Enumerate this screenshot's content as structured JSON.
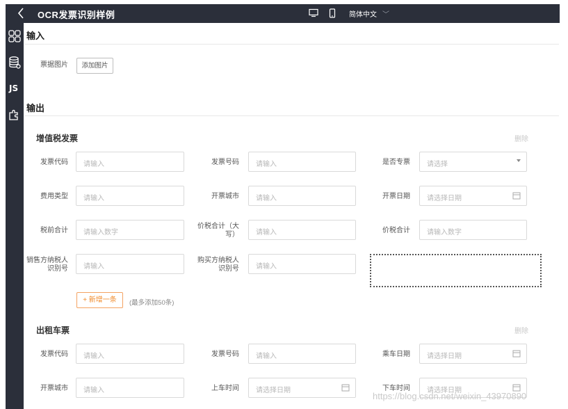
{
  "topbar": {
    "title": "OCR发票识别样例",
    "language": "简体中文"
  },
  "sidebar": {
    "js_label": "JS"
  },
  "input_section": {
    "title": "输入",
    "field_label": "票据图片",
    "add_button": "添加图片"
  },
  "output_section": {
    "title": "输出"
  },
  "vat": {
    "title": "增值税发票",
    "delete": "删除",
    "fields": {
      "invoice_code": {
        "label": "发票代码",
        "placeholder": "请输入"
      },
      "invoice_number": {
        "label": "发票号码",
        "placeholder": "请输入"
      },
      "is_special": {
        "label": "是否专票",
        "placeholder": "请选择"
      },
      "fee_type": {
        "label": "费用类型",
        "placeholder": "请输入"
      },
      "issue_city": {
        "label": "开票城市",
        "placeholder": "请输入"
      },
      "issue_date": {
        "label": "开票日期",
        "placeholder": "请选择日期"
      },
      "pretax_total": {
        "label": "税前合计",
        "placeholder": "请输入数字"
      },
      "total_upper_l1": "价税合计（大",
      "total_upper_l2": "写）",
      "total_upper_placeholder": "请输入",
      "total": {
        "label": "价税合计",
        "placeholder": "请输入数字"
      },
      "seller_l1": "销售方纳税人",
      "seller_l2": "识别号",
      "seller_placeholder": "请输入",
      "buyer_l1": "购买方纳税人",
      "buyer_l2": "识别号",
      "buyer_placeholder": "请输入"
    },
    "add_row": "+ 新增一条",
    "add_hint": "(最多添加50条)"
  },
  "taxi": {
    "title": "出租车票",
    "delete": "删除",
    "fields": {
      "invoice_code": {
        "label": "发票代码",
        "placeholder": "请输入"
      },
      "invoice_number": {
        "label": "发票号码",
        "placeholder": "请输入"
      },
      "ride_date": {
        "label": "乘车日期",
        "placeholder": "请选择日期"
      },
      "issue_city": {
        "label": "开票城市",
        "placeholder": "请输入"
      },
      "board_time": {
        "label": "上车时间",
        "placeholder": "请选择日期"
      },
      "alight_time": {
        "label": "下车时间",
        "placeholder": "请选择日期"
      }
    }
  },
  "watermark": "https://blog.csdn.net/weixin_43970890",
  "colors": {
    "dark_bar": "#2b2f3a",
    "accent_orange": "#f08c2e"
  }
}
